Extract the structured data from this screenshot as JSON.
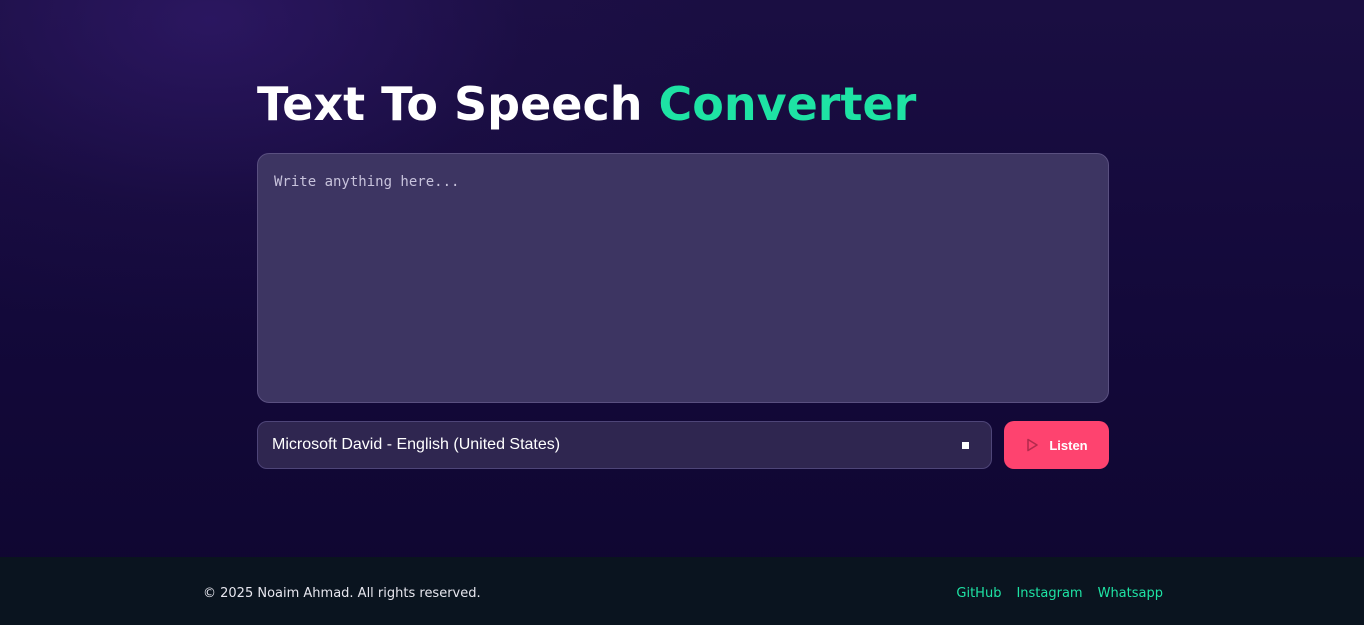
{
  "header": {
    "title_main": "Text To Speech",
    "title_accent": "Converter"
  },
  "editor": {
    "placeholder": "Write anything here...",
    "value": ""
  },
  "controls": {
    "voice_selected": "Microsoft David - English (United States)",
    "listen_label": "Listen",
    "listen_icon": "play-icon",
    "dropdown_icon": "square-caret-icon"
  },
  "footer": {
    "copyright": "© 2025 Noaim Ahmad. All rights reserved.",
    "links": [
      {
        "label": "GitHub"
      },
      {
        "label": "Instagram"
      },
      {
        "label": "Whatsapp"
      }
    ]
  },
  "colors": {
    "accent_green": "#1ee3a4",
    "listen_button": "#fe436f",
    "background": "#13082f",
    "footer_background": "#0a141f",
    "textarea_background": "#3d3562"
  }
}
